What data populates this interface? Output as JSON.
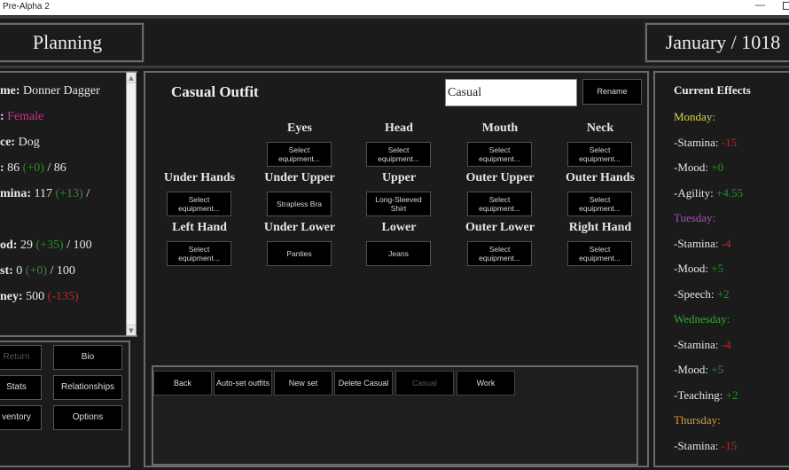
{
  "window": {
    "title": "Pre-Alpha 2",
    "minimize_icon": "—"
  },
  "header": {
    "screen_title": "Planning",
    "date": "January / 1018"
  },
  "character": {
    "lines": [
      {
        "label": "me:",
        "value": "Donner Dagger"
      },
      {
        "label": ":",
        "value": "Female",
        "value_color": "pink"
      },
      {
        "label": "ce:",
        "value": "Dog"
      },
      {
        "label": ":",
        "value": "86",
        "delta": "(+0)",
        "delta_type": "pos",
        "suffix": "/ 86"
      },
      {
        "label": "mina:",
        "value": "117",
        "delta": "(+13)",
        "delta_type": "pos",
        "suffix": "/"
      },
      {
        "label": "",
        "value": ""
      },
      {
        "label": "od:",
        "value": "29",
        "delta": "(+35)",
        "delta_type": "pos",
        "suffix": "/ 100"
      },
      {
        "label": "st:",
        "value": "0",
        "delta": "(+0)",
        "delta_type": "pos",
        "suffix": "/ 100"
      },
      {
        "label": "ney:",
        "value": "500",
        "delta": "(-135)",
        "delta_type": "neg",
        "suffix": ""
      }
    ],
    "scroll_up_icon": "▲",
    "scroll_down_icon": "▼"
  },
  "menu": {
    "return": "Return",
    "bio": "Bio",
    "stats": "Stats",
    "relationships": "Relationships",
    "inventory": "ventory",
    "options": "Options"
  },
  "outfit": {
    "title": "Casual Outfit",
    "name_value": "Casual",
    "rename_label": "Rename",
    "slots": [
      {
        "label": "Eyes",
        "item": "Select equipment..."
      },
      {
        "label": "Head",
        "item": "Select equipment..."
      },
      {
        "label": "Mouth",
        "item": "Select equipment..."
      },
      {
        "label": "Neck",
        "item": "Select equipment..."
      },
      {
        "label": "Under Hands",
        "item": "Select equipment..."
      },
      {
        "label": "Under Upper",
        "item": "Strapless Bra"
      },
      {
        "label": "Upper",
        "item": "Long-Sleeved Shirt"
      },
      {
        "label": "Outer Upper",
        "item": "Select equipment..."
      },
      {
        "label": "Outer Hands",
        "item": "Select equipment..."
      },
      {
        "label": "Left Hand",
        "item": "Select equipment..."
      },
      {
        "label": "Under Lower",
        "item": "Panties"
      },
      {
        "label": "Lower",
        "item": "Jeans"
      },
      {
        "label": "Outer Lower",
        "item": "Select equipment..."
      },
      {
        "label": "Right Hand",
        "item": "Select equipment..."
      }
    ]
  },
  "set_buttons": {
    "back": "Back",
    "auto_set": "Auto-set outfits",
    "new_set": "New set",
    "delete": "Delete Casual",
    "casual": "Casual",
    "work": "Work"
  },
  "effects": {
    "title": "Current Effects",
    "colors": {
      "pos": "#2f8a2f",
      "neg": "#c42525",
      "monday": "#d4d44a",
      "tuesday": "#a055b0",
      "wednesday": "#2fae2f",
      "thursday": "#d49a30"
    },
    "lines": [
      {
        "text": "Monday:",
        "kind": "day",
        "color": "#d4d44a"
      },
      {
        "text": "-Stamina:",
        "value": "-15",
        "kind": "neg"
      },
      {
        "text": "-Mood:",
        "value": "+0",
        "kind": "pos"
      },
      {
        "text": "-Agility:",
        "value": "+4.55",
        "kind": "pos"
      },
      {
        "text": "Tuesday:",
        "kind": "day",
        "color": "#a055b0"
      },
      {
        "text": "-Stamina:",
        "value": "-4",
        "kind": "neg"
      },
      {
        "text": "-Mood:",
        "value": "+5",
        "kind": "pos"
      },
      {
        "text": "-Speech:",
        "value": "+2",
        "kind": "pos"
      },
      {
        "text": "Wednesday:",
        "kind": "day",
        "color": "#2fae2f"
      },
      {
        "text": "-Stamina:",
        "value": "-4",
        "kind": "neg"
      },
      {
        "text": "-Mood:",
        "value": "+5",
        "kind": "pos"
      },
      {
        "text": "-Teaching:",
        "value": "+2",
        "kind": "pos"
      },
      {
        "text": "Thursday:",
        "kind": "day",
        "color": "#d49a30"
      },
      {
        "text": "-Stamina:",
        "value": "-15",
        "kind": "neg"
      }
    ]
  }
}
